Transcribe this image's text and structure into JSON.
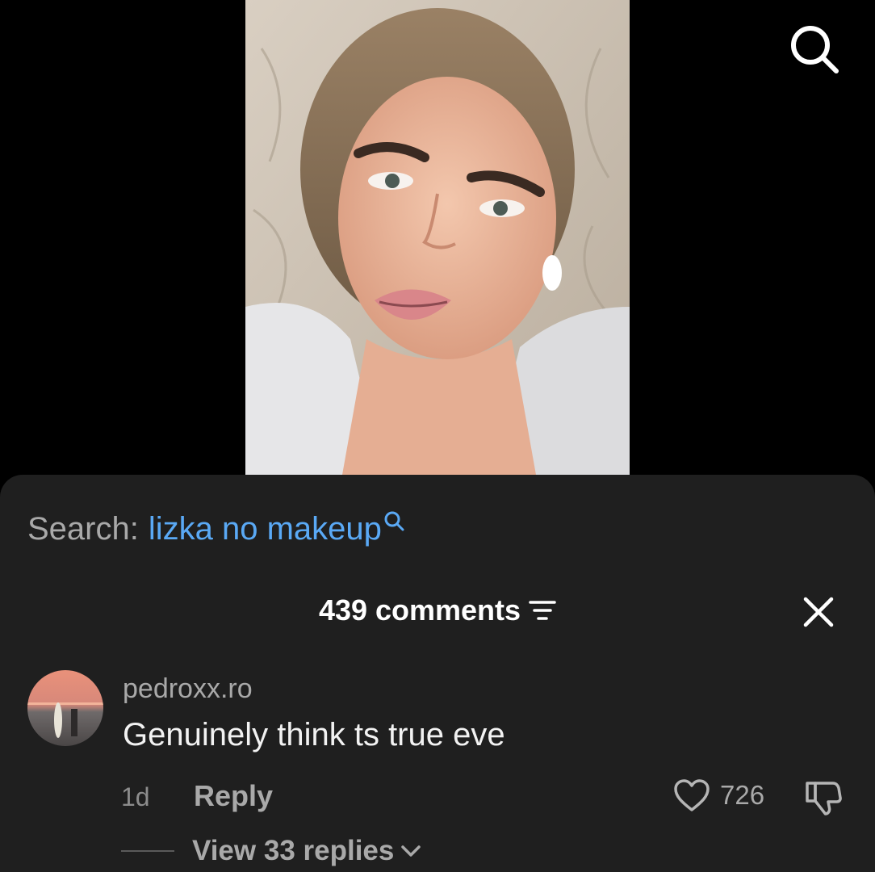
{
  "video": {
    "thumbnail_icon": "video-thumbnail"
  },
  "top_bar": {
    "search_icon": "search-icon"
  },
  "search_suggestion": {
    "prefix": "Search:",
    "term": "lizka no makeup",
    "icon": "search-icon",
    "term_color": "#5aa9f5"
  },
  "comments_header": {
    "count_label": "439 comments",
    "sort_icon": "sort-icon",
    "close_icon": "close-icon"
  },
  "comments": [
    {
      "username": "pedroxx.ro",
      "text": "Genuinely think ts true eve",
      "time": "1d",
      "reply_label": "Reply",
      "likes": "726",
      "like_icon": "heart-icon",
      "dislike_icon": "thumbs-down-icon",
      "view_replies_label": "View 33 replies",
      "view_replies_icon": "chevron-down-icon"
    }
  ],
  "colors": {
    "sheet_background": "#1f1f1f",
    "page_background": "#000000",
    "accent_link": "#5aa9f5"
  }
}
